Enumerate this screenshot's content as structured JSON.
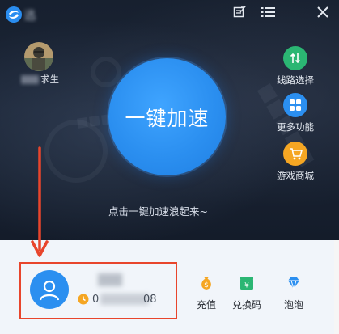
{
  "titlebar": {
    "app_title": "迅",
    "buttons": {
      "notes_icon": "notes-icon",
      "menu_icon": "menu-icon",
      "close_icon": "close-icon"
    }
  },
  "game": {
    "label_suffix": "求生",
    "icon": "game-avatar-icon"
  },
  "accelerate": {
    "button_label": "一键加速",
    "hint": "点击一键加速浪起来~"
  },
  "features": [
    {
      "label": "线路选择",
      "icon": "route-icon",
      "color": "#2bb673"
    },
    {
      "label": "更多功能",
      "icon": "grid-icon",
      "color": "#2b8ff0"
    },
    {
      "label": "游戏商城",
      "icon": "cart-icon",
      "color": "#f5a623"
    }
  ],
  "user": {
    "avatar_icon": "user-avatar-icon",
    "time_prefix": "0",
    "time_suffix": "08"
  },
  "bottom_actions": [
    {
      "label": "充值",
      "icon": "money-bag-icon",
      "color": "#f5a623"
    },
    {
      "label": "兑换码",
      "icon": "gift-code-icon",
      "color": "#2bb673"
    },
    {
      "label": "泡泡",
      "icon": "diamond-icon",
      "color": "#2b8ff0"
    }
  ],
  "colors": {
    "accent": "#2b8ff0",
    "annotation": "#e8452c"
  }
}
